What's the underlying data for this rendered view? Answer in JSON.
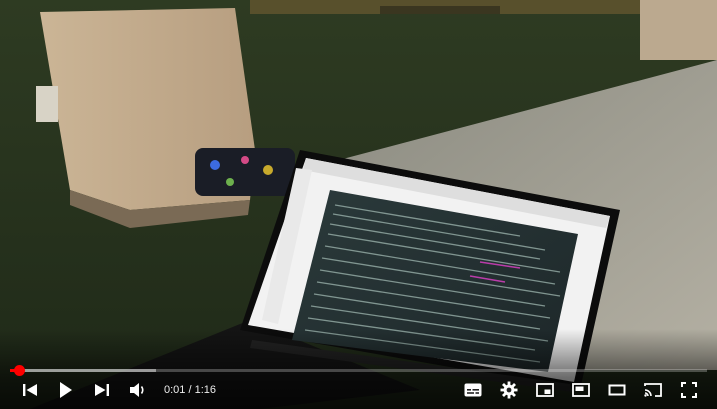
{
  "player": {
    "time_current": "0:01",
    "time_separator": " / ",
    "time_duration": "1:16",
    "progress_played": 0.013,
    "progress_buffered": 0.21
  },
  "colors": {
    "progress_played": "#ff0000",
    "icon": "#ffffff"
  },
  "icons": [
    "previous-icon",
    "play-icon",
    "next-icon",
    "volume-icon",
    "subtitles-icon",
    "settings-gear-icon",
    "miniplayer-icon",
    "picture-in-picture-icon",
    "theater-mode-icon",
    "cast-icon",
    "fullscreen-icon"
  ]
}
